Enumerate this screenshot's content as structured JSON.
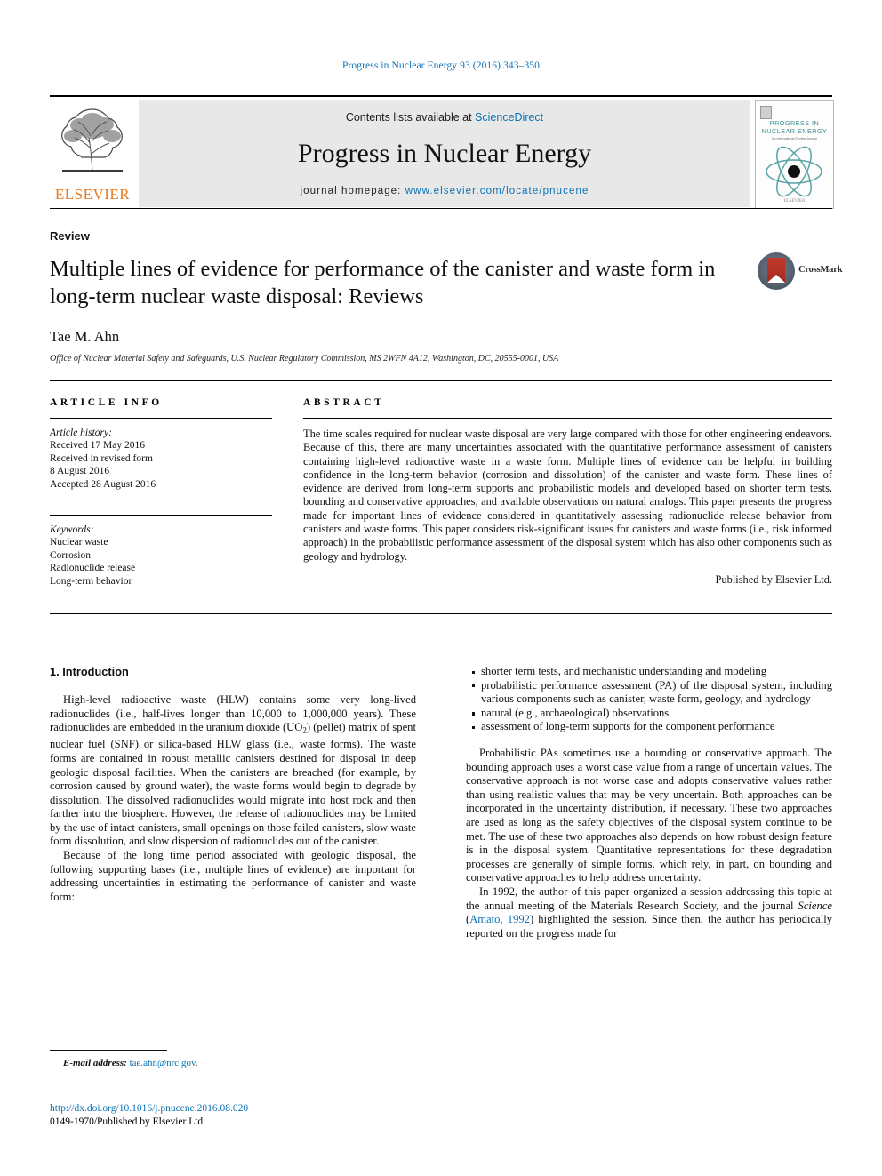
{
  "running_head": "Progress in Nuclear Energy 93 (2016) 343–350",
  "masthead": {
    "contents_prefix": "Contents lists available at ",
    "sciencedirect": "ScienceDirect",
    "journal_name": "Progress in Nuclear Energy",
    "homepage_label": "journal homepage: ",
    "homepage_url": "www.elsevier.com/locate/pnucene",
    "publisher_wordmark": "ELSEVIER",
    "cover": {
      "title": "PROGRESS IN NUCLEAR ENERGY",
      "subtitle": "An International Review Journal",
      "footer": "ELSEVIER"
    },
    "accent_color": "#0b72b5",
    "elsevier_orange": "#e87b1e"
  },
  "article": {
    "type": "Review",
    "title": "Multiple lines of evidence for performance of the canister and waste form in long-term nuclear waste disposal: Reviews",
    "author": "Tae M. Ahn",
    "affiliation": "Office of Nuclear Material Safety and Safeguards, U.S. Nuclear Regulatory Commission, MS 2WFN 4A12, Washington, DC, 20555-0001, USA",
    "crossmark_label": "CrossMark"
  },
  "article_info": {
    "heading": "ARTICLE INFO",
    "history_label": "Article history:",
    "history": [
      "Received 17 May 2016",
      "Received in revised form",
      "8 August 2016",
      "Accepted 28 August 2016"
    ],
    "keywords_label": "Keywords:",
    "keywords": [
      "Nuclear waste",
      "Corrosion",
      "Radionuclide release",
      "Long-term behavior"
    ]
  },
  "abstract": {
    "heading": "ABSTRACT",
    "text": "The time scales required for nuclear waste disposal are very large compared with those for other engineering endeavors. Because of this, there are many uncertainties associated with the quantitative performance assessment of canisters containing high-level radioactive waste in a waste form. Multiple lines of evidence can be helpful in building confidence in the long-term behavior (corrosion and dissolution) of the canister and waste form. These lines of evidence are derived from long-term supports and probabilistic models and developed based on shorter term tests, bounding and conservative approaches, and available observations on natural analogs. This paper presents the progress made for important lines of evidence considered in quantitatively assessing radionuclide release behavior from canisters and waste forms. This paper considers risk-significant issues for canisters and waste forms (i.e., risk informed approach) in the probabilistic performance assessment of the disposal system which has also other components such as geology and hydrology.",
    "published_by": "Published by Elsevier Ltd."
  },
  "body": {
    "section_heading": "1. Introduction",
    "left_paragraph_1_a": "High-level radioactive waste (HLW) contains some very long-lived radionuclides (i.e., half-lives longer than 10,000 to 1,000,000 years). These radionuclides are embedded in the uranium dioxide (UO",
    "left_paragraph_1_sub": "2",
    "left_paragraph_1_b": ") (pellet) matrix of spent nuclear fuel (SNF) or silica-based HLW glass (i.e., waste forms). The waste forms are contained in robust metallic canisters destined for disposal in deep geologic disposal facilities. When the canisters are breached (for example, by corrosion caused by ground water), the waste forms would begin to degrade by dissolution. The dissolved radionuclides would migrate into host rock and then farther into the biosphere. However, the release of radionuclides may be limited by the use of intact canisters, small openings on those failed canisters, slow waste form dissolution, and slow dispersion of radionuclides out of the canister.",
    "left_paragraph_2": "Because of the long time period associated with geologic disposal, the following supporting bases (i.e., multiple lines of evidence) are important for addressing uncertainties in estimating the performance of canister and waste form:",
    "bullets": [
      "shorter term tests, and mechanistic understanding and modeling",
      "probabilistic performance assessment (PA) of the disposal system, including various components such as canister, waste form, geology, and hydrology",
      "natural (e.g., archaeological) observations",
      "assessment of long-term supports for the component performance"
    ],
    "right_paragraph_1": "Probabilistic PAs sometimes use a bounding or conservative approach. The bounding approach uses a worst case value from a range of uncertain values. The conservative approach is not worse case and adopts conservative values rather than using realistic values that may be very uncertain. Both approaches can be incorporated in the uncertainty distribution, if necessary. These two approaches are used as long as the safety objectives of the disposal system continue to be met. The use of these two approaches also depends on how robust design feature is in the disposal system. Quantitative representations for these degradation processes are generally of simple forms, which rely, in part, on bounding and conservative approaches to help address uncertainty.",
    "right_paragraph_2_a": "In 1992, the author of this paper organized a session addressing this topic at the annual meeting of the Materials Research Society, and the journal ",
    "right_paragraph_2_journal": "Science",
    "right_paragraph_2_b": " (",
    "right_paragraph_2_citation": "Amato, 1992",
    "right_paragraph_2_c": ") highlighted the session. Since then, the author has periodically reported on the progress made for"
  },
  "footer": {
    "email_label": "E-mail address:",
    "email": "tae.ahn@nrc.gov",
    "email_trailing": ".",
    "doi": "http://dx.doi.org/10.1016/j.pnucene.2016.08.020",
    "issn_line": "0149-1970/Published by Elsevier Ltd."
  }
}
